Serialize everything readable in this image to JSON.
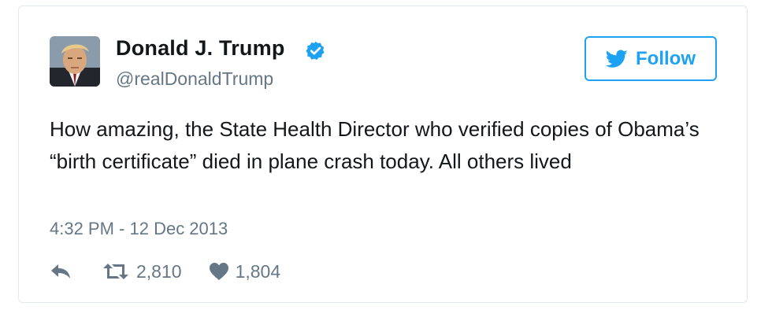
{
  "tweet": {
    "author_name": "Donald J. Trump",
    "handle": "@realDonaldTrump",
    "verified_icon": "verified-badge-icon",
    "follow_label": "Follow",
    "text": "How amazing, the State Health Director who verified copies of Obama’s “birth certificate” died in plane crash today. All others lived",
    "timestamp": "4:32 PM - 12 Dec 2013",
    "retweets": "2,810",
    "likes": "1,804"
  },
  "colors": {
    "accent": "#1da1f2",
    "secondary_text": "#657786",
    "border": "#e1e8ed"
  },
  "icons": [
    "twitter-bird-icon",
    "reply-icon",
    "retweet-icon",
    "heart-icon"
  ]
}
